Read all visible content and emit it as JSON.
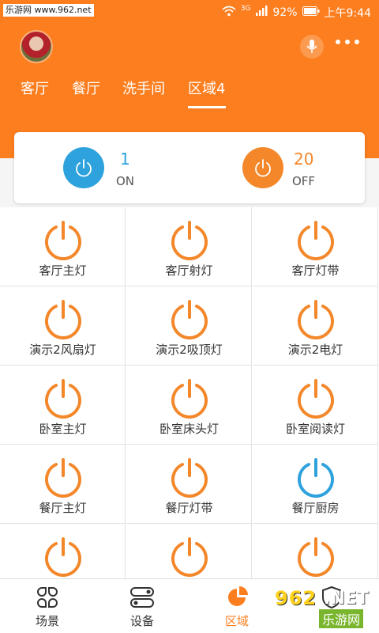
{
  "watermark": "乐游网 www.962.net",
  "status": {
    "signal": "3G",
    "battery": "92%",
    "time": "上午9:44"
  },
  "header": {
    "tabs": [
      {
        "label": "客厅"
      },
      {
        "label": "餐厅"
      },
      {
        "label": "洗手间"
      },
      {
        "label": "区域4",
        "active": true
      }
    ]
  },
  "summary": {
    "on_count": "1",
    "on_label": "ON",
    "off_count": "20",
    "off_label": "OFF"
  },
  "devices": [
    {
      "label": "客厅主灯",
      "on": false
    },
    {
      "label": "客厅射灯",
      "on": false
    },
    {
      "label": "客厅灯带",
      "on": false
    },
    {
      "label": "演示2风扇灯",
      "on": false
    },
    {
      "label": "演示2吸顶灯",
      "on": false
    },
    {
      "label": "演示2电灯",
      "on": false
    },
    {
      "label": "卧室主灯",
      "on": false
    },
    {
      "label": "卧室床头灯",
      "on": false
    },
    {
      "label": "卧室阅读灯",
      "on": false
    },
    {
      "label": "餐厅主灯",
      "on": false
    },
    {
      "label": "餐厅灯带",
      "on": false
    },
    {
      "label": "餐厅厨房",
      "on": true
    },
    {
      "label": "",
      "on": false
    },
    {
      "label": "",
      "on": false
    },
    {
      "label": "",
      "on": false
    }
  ],
  "nav": [
    {
      "label": "场景",
      "icon": "scene-icon"
    },
    {
      "label": "设备",
      "icon": "device-icon"
    },
    {
      "label": "区域",
      "icon": "area-icon",
      "active": true
    },
    {
      "label": "",
      "icon": "shield-icon"
    }
  ],
  "logo": {
    "text1": "962",
    "text2": ".NET",
    "text3": "乐游网"
  },
  "colors": {
    "accent": "#fd7e1f",
    "on": "#2ea2dd",
    "off": "#f3872a"
  }
}
